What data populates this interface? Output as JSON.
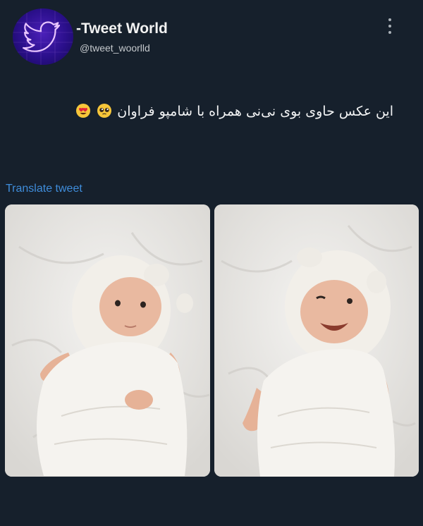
{
  "tweet": {
    "author_name": "-Tweet World",
    "author_handle": "@tweet_woorlld",
    "text": "این عکس حاوی بوی نی‌نی همراه با شامپو فراوان",
    "text_emojis": [
      "smiling-face-with-heart-eyes",
      "pleading-face"
    ],
    "translate_label": "Translate tweet",
    "photos": [
      {
        "description_icon": "photo-baby-calm"
      },
      {
        "description_icon": "photo-baby-smiling"
      }
    ]
  },
  "colors": {
    "background": "#16202c",
    "link": "#3f8ddb",
    "avatar_purple": "#3a17a8",
    "text": "#f2f3f4"
  }
}
